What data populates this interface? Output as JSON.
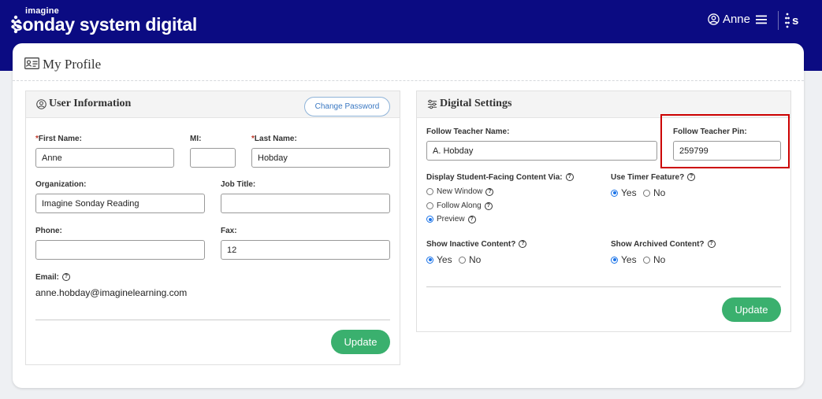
{
  "header": {
    "brand_small": "imagine",
    "brand_main": "sonday system",
    "brand_bold": "digital",
    "user_name": "Anne"
  },
  "page": {
    "title": "My Profile"
  },
  "user_info": {
    "title": "User Information",
    "change_password": "Change Password",
    "first_name_label": "First Name:",
    "first_name_value": "Anne",
    "mi_label": "MI:",
    "mi_value": "",
    "last_name_label": "Last Name:",
    "last_name_value": "Hobday",
    "organization_label": "Organization:",
    "organization_value": "Imagine Sonday Reading",
    "job_title_label": "Job Title:",
    "job_title_value": "",
    "phone_label": "Phone:",
    "phone_value": "",
    "fax_label": "Fax:",
    "fax_value": "12",
    "email_label": "Email:",
    "email_value": "anne.hobday@imaginelearning.com",
    "update": "Update",
    "required_mark": "*"
  },
  "digital_settings": {
    "title": "Digital Settings",
    "teacher_name_label": "Follow Teacher Name:",
    "teacher_name_value": "A. Hobday",
    "teacher_pin_label": "Follow Teacher Pin:",
    "teacher_pin_value": "259799",
    "display_label": "Display Student-Facing Content Via:",
    "display_options": [
      "New Window",
      "Follow Along",
      "Preview"
    ],
    "display_selected": "Preview",
    "timer_label": "Use Timer Feature?",
    "inactive_label": "Show Inactive Content?",
    "archived_label": "Show Archived Content?",
    "yes": "Yes",
    "no": "No",
    "timer_selected": "Yes",
    "inactive_selected": "Yes",
    "archived_selected": "Yes",
    "update": "Update"
  },
  "colors": {
    "topbar": "#0b0b82",
    "update_button": "#3ab06e",
    "highlight_border": "#cc0000",
    "radio_selected": "#1a73e8"
  },
  "icons": [
    "user-circle-icon",
    "menu-icon",
    "sonday-s-logo-icon",
    "id-card-icon",
    "sliders-icon",
    "help-icon"
  ]
}
